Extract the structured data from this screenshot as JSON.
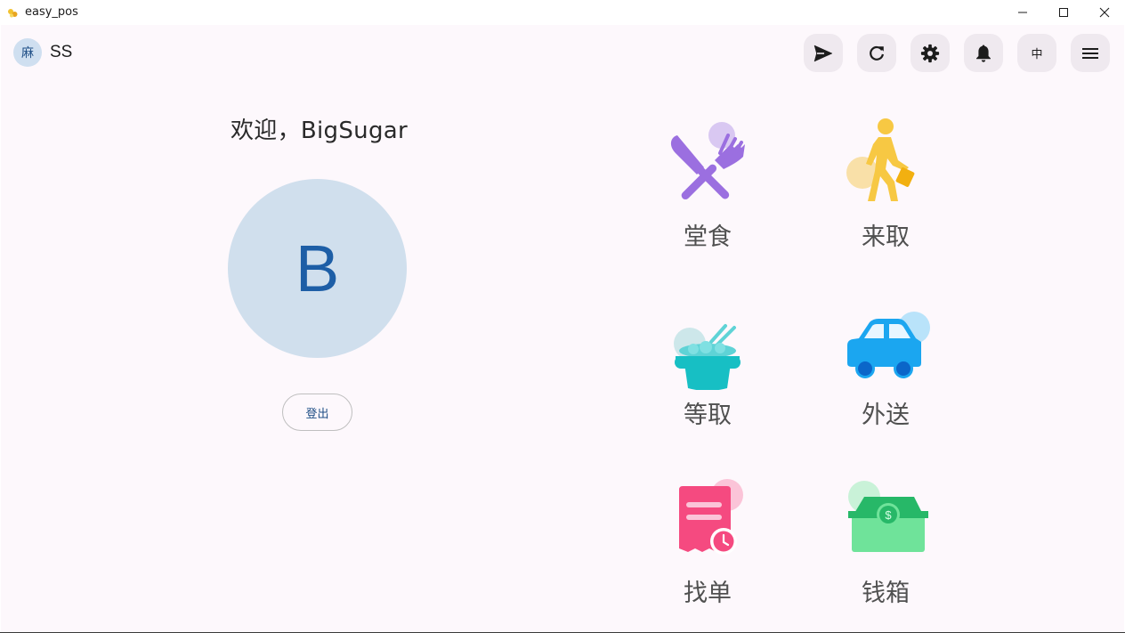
{
  "window": {
    "title": "easy_pos"
  },
  "header": {
    "avatar_text": "麻",
    "user_name": "SS",
    "lang_label": "中",
    "buttons": [
      "send-icon",
      "refresh-icon",
      "gear-icon",
      "bell-icon",
      "language-toggle",
      "menu-icon"
    ]
  },
  "profile": {
    "welcome": "欢迎，BigSugar",
    "avatar_letter": "B",
    "logout_label": "登出"
  },
  "tiles": [
    {
      "label": "堂食",
      "icon": "fork-knife-icon"
    },
    {
      "label": "来取",
      "icon": "walking-person-icon"
    },
    {
      "label": "等取",
      "icon": "rice-bowl-icon"
    },
    {
      "label": "外送",
      "icon": "car-icon"
    },
    {
      "label": "找单",
      "icon": "receipt-clock-icon"
    },
    {
      "label": "钱箱",
      "icon": "cash-box-icon"
    }
  ],
  "colors": {
    "background": "#fdf8fc",
    "avatar_bg": "#d0dfed",
    "avatar_text": "#1d5ea6",
    "fork_knife": "#9b6fe0",
    "person": "#f7c843",
    "bowl": "#17bfc4",
    "car": "#1ba6f0",
    "receipt": "#f54a80",
    "cash_box": "#6fe39a"
  }
}
